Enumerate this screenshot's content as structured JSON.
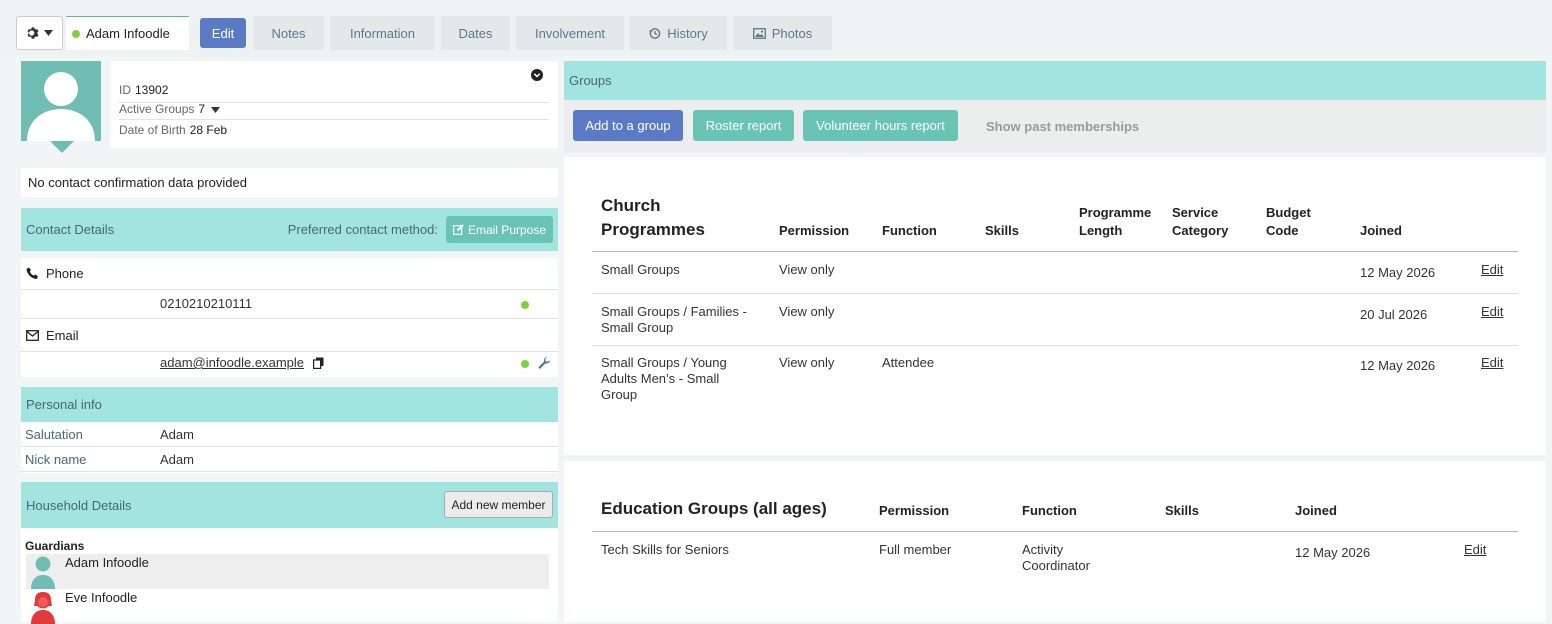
{
  "header": {
    "person_name": "Adam Infoodle",
    "tabs": [
      {
        "label": "Edit"
      },
      {
        "label": "Notes"
      },
      {
        "label": "Information"
      },
      {
        "label": "Dates"
      },
      {
        "label": "Involvement"
      },
      {
        "label": "History",
        "icon": "history-icon"
      },
      {
        "label": "Photos",
        "icon": "image-icon"
      }
    ]
  },
  "profile": {
    "id_label": "ID",
    "id_value": "13902",
    "active_groups_label": "Active Groups",
    "active_groups_value": "7",
    "dob_label": "Date of Birth",
    "dob_value": "28 Feb"
  },
  "confirmation": "No contact confirmation data provided",
  "contact": {
    "title": "Contact Details",
    "preferred_label": "Preferred contact method:",
    "email_purpose_button": "Email Purpose",
    "phone_label": "Phone",
    "phone_value": "0210210210111",
    "email_label": "Email",
    "email_value": "adam@infoodle.example"
  },
  "personal": {
    "title": "Personal info",
    "rows": [
      {
        "label": "Salutation",
        "value": "Adam"
      },
      {
        "label": "Nick name",
        "value": "Adam"
      }
    ]
  },
  "household": {
    "title": "Household Details",
    "add_button": "Add new member",
    "guardians_label": "Guardians",
    "members": [
      {
        "name": "Adam Infoodle"
      },
      {
        "name": "Eve Infoodle"
      }
    ]
  },
  "groups": {
    "title": "Groups",
    "buttons": {
      "add": "Add to a group",
      "roster": "Roster report",
      "volunteer": "Volunteer hours report",
      "past": "Show past memberships"
    },
    "church": {
      "title_line1": "Church",
      "title_line2": "Programmes",
      "headers": {
        "permission": "Permission",
        "function": "Function",
        "skills": "Skills",
        "length_1": "Programme",
        "length_2": "Length",
        "service_1": "Service",
        "service_2": "Category",
        "budget_1": "Budget",
        "budget_2": "Code",
        "joined": "Joined"
      },
      "rows": [
        {
          "name_1": "Small Groups",
          "name_2": "",
          "name_3": "",
          "permission": "View only",
          "function": "",
          "joined": "12 May 2026",
          "edit": "Edit"
        },
        {
          "name_1": "Small Groups / Families -",
          "name_2": "Small Group",
          "name_3": "",
          "permission": "View only",
          "function": "",
          "joined": "20 Jul 2026",
          "edit": "Edit"
        },
        {
          "name_1": "Small Groups / Young",
          "name_2": "Adults Men’s - Small",
          "name_3": "Group",
          "permission": "View only",
          "function": "Attendee",
          "joined": "12 May 2026",
          "edit": "Edit"
        }
      ]
    },
    "education": {
      "title": "Education Groups (all ages)",
      "headers": {
        "permission": "Permission",
        "function": "Function",
        "skills": "Skills",
        "joined": "Joined"
      },
      "rows": [
        {
          "name": "Tech Skills for Seniors",
          "permission": "Full member",
          "function_1": "Activity",
          "function_2": "Coordinator",
          "joined": "12 May 2026",
          "edit": "Edit"
        }
      ]
    }
  },
  "colors": {
    "teal_header": "#a2e4df",
    "teal_button": "#6ac4b6",
    "blue_button": "#5b7ac6",
    "status_green": "#7ed03c"
  }
}
